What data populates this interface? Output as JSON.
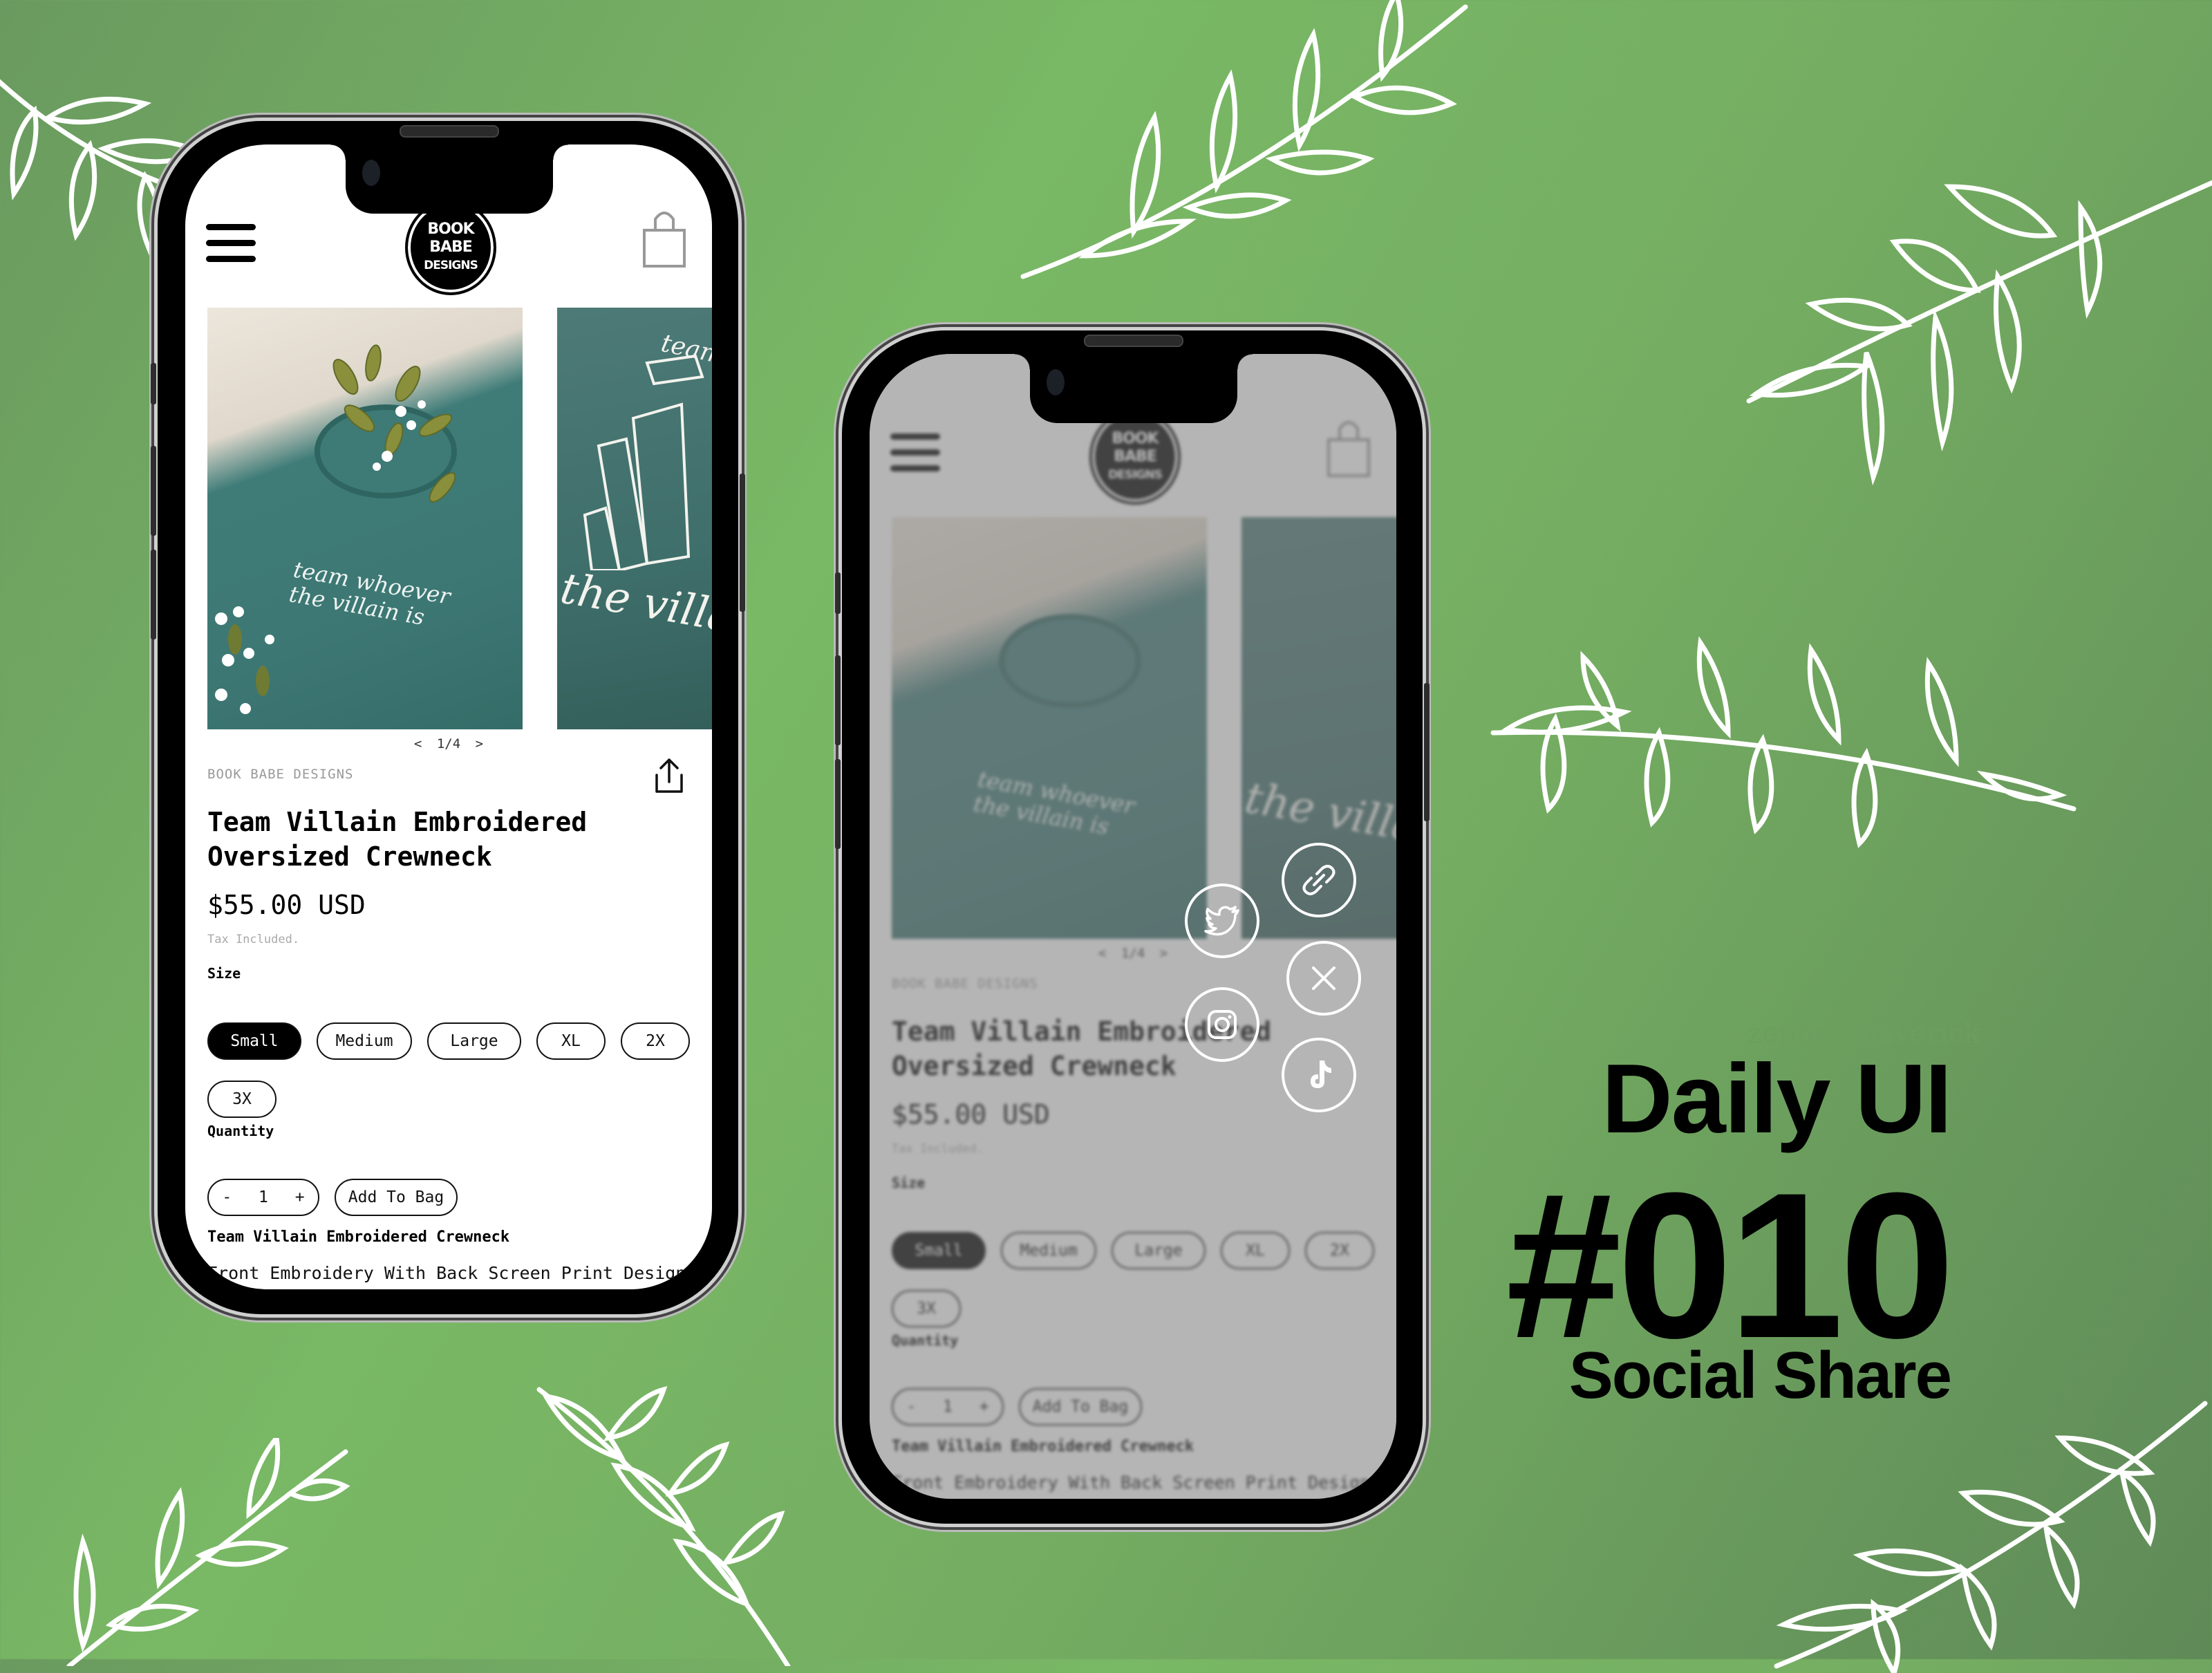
{
  "heading": {
    "watermark": "zephyr maverick",
    "series": "Daily UI",
    "number": "#010",
    "subtitle": "Social Share"
  },
  "colors": {
    "background_green": "#79b865",
    "background_dark": "#5f8a58",
    "ink": "#000000",
    "muted_text": "#999999",
    "overlay_gray": "#b4b4b4",
    "share_icon_stroke": "#ffffff"
  },
  "product_page": {
    "header": {
      "menu_icon": "hamburger-icon",
      "logo_lines": [
        "BOOK",
        "BABE",
        "DESIGNS"
      ],
      "cart_icon": "shopping-bag-icon"
    },
    "gallery": {
      "pager_prev": "<",
      "pager_text": "1/4",
      "pager_next": ">",
      "photo1_text_line1": "team whoever",
      "photo1_text_line2": "the villain is",
      "photo2_text_top": "team",
      "photo2_text": "the villa"
    },
    "brand": "BOOK BABE DESIGNS",
    "share_icon": "share-upload-icon",
    "title_line1": "Team Villain Embroidered",
    "title_line2": "Oversized Crewneck",
    "price": "$55.00 USD",
    "tax_note": "Tax Included.",
    "size_label": "Size",
    "sizes": [
      {
        "label": "Small",
        "selected": true
      },
      {
        "label": "Medium",
        "selected": false
      },
      {
        "label": "Large",
        "selected": false
      },
      {
        "label": "XL",
        "selected": false
      },
      {
        "label": "2X",
        "selected": false
      },
      {
        "label": "3X",
        "selected": false
      }
    ],
    "quantity_label": "Quantity",
    "quantity": {
      "minus": "-",
      "value": "1",
      "plus": "+"
    },
    "add_to_bag": "Add To Bag",
    "description_title": "Team Villain Embroidered Crewneck",
    "description": "Front Embroidery With Back Screen Print Design"
  },
  "share_menu": {
    "buttons": [
      {
        "id": "copy-link",
        "icon": "link-icon"
      },
      {
        "id": "twitter",
        "icon": "twitter-bird-icon"
      },
      {
        "id": "close",
        "icon": "close-x-icon"
      },
      {
        "id": "instagram",
        "icon": "instagram-icon"
      },
      {
        "id": "tiktok",
        "icon": "tiktok-icon"
      }
    ]
  }
}
